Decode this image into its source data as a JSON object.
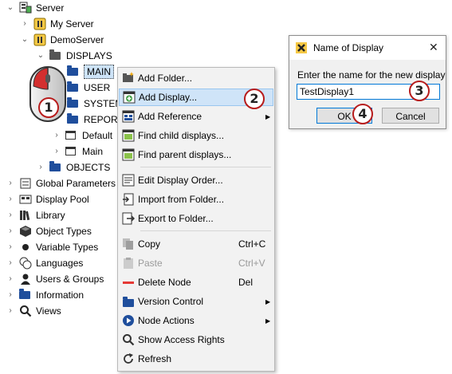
{
  "tree": {
    "root": "Server",
    "my_server": "My Server",
    "demo_server": "DemoServer",
    "displays": "DISPLAYS",
    "main": "MAIN",
    "user": "USER",
    "system": "SYSTEM",
    "report": "REPORT",
    "default": "Default",
    "main_display": "Main",
    "objects": "OBJECTS",
    "global_parameters": "Global Parameters",
    "display_pool": "Display Pool",
    "library": "Library",
    "object_types": "Object Types",
    "variable_types": "Variable Types",
    "languages": "Languages",
    "users_groups": "Users & Groups",
    "information": "Information",
    "views": "Views"
  },
  "context_menu": {
    "add_folder": "Add Folder...",
    "add_display": "Add Display...",
    "add_reference": "Add Reference",
    "find_child": "Find child displays...",
    "find_parent": "Find parent displays...",
    "edit_order": "Edit Display Order...",
    "import_folder": "Import from Folder...",
    "export_folder": "Export to Folder...",
    "copy": "Copy",
    "copy_shortcut": "Ctrl+C",
    "paste": "Paste",
    "paste_shortcut": "Ctrl+V",
    "delete_node": "Delete Node",
    "delete_shortcut": "Del",
    "version_control": "Version Control",
    "node_actions": "Node Actions",
    "show_access_rights": "Show Access Rights",
    "refresh": "Refresh"
  },
  "dialog": {
    "title": "Name of Display",
    "prompt": "Enter the name for the new display",
    "input_value": "TestDisplay1",
    "ok": "OK",
    "cancel": "Cancel",
    "close_glyph": "✕"
  },
  "steps": {
    "s1": "1",
    "s2": "2",
    "s3": "3",
    "s4": "4"
  },
  "colors": {
    "highlight": "#cfe4f8",
    "folder": "#1f4e9c",
    "badge_ring": "#b71c1c",
    "mouse_button": "#d32f2f"
  }
}
